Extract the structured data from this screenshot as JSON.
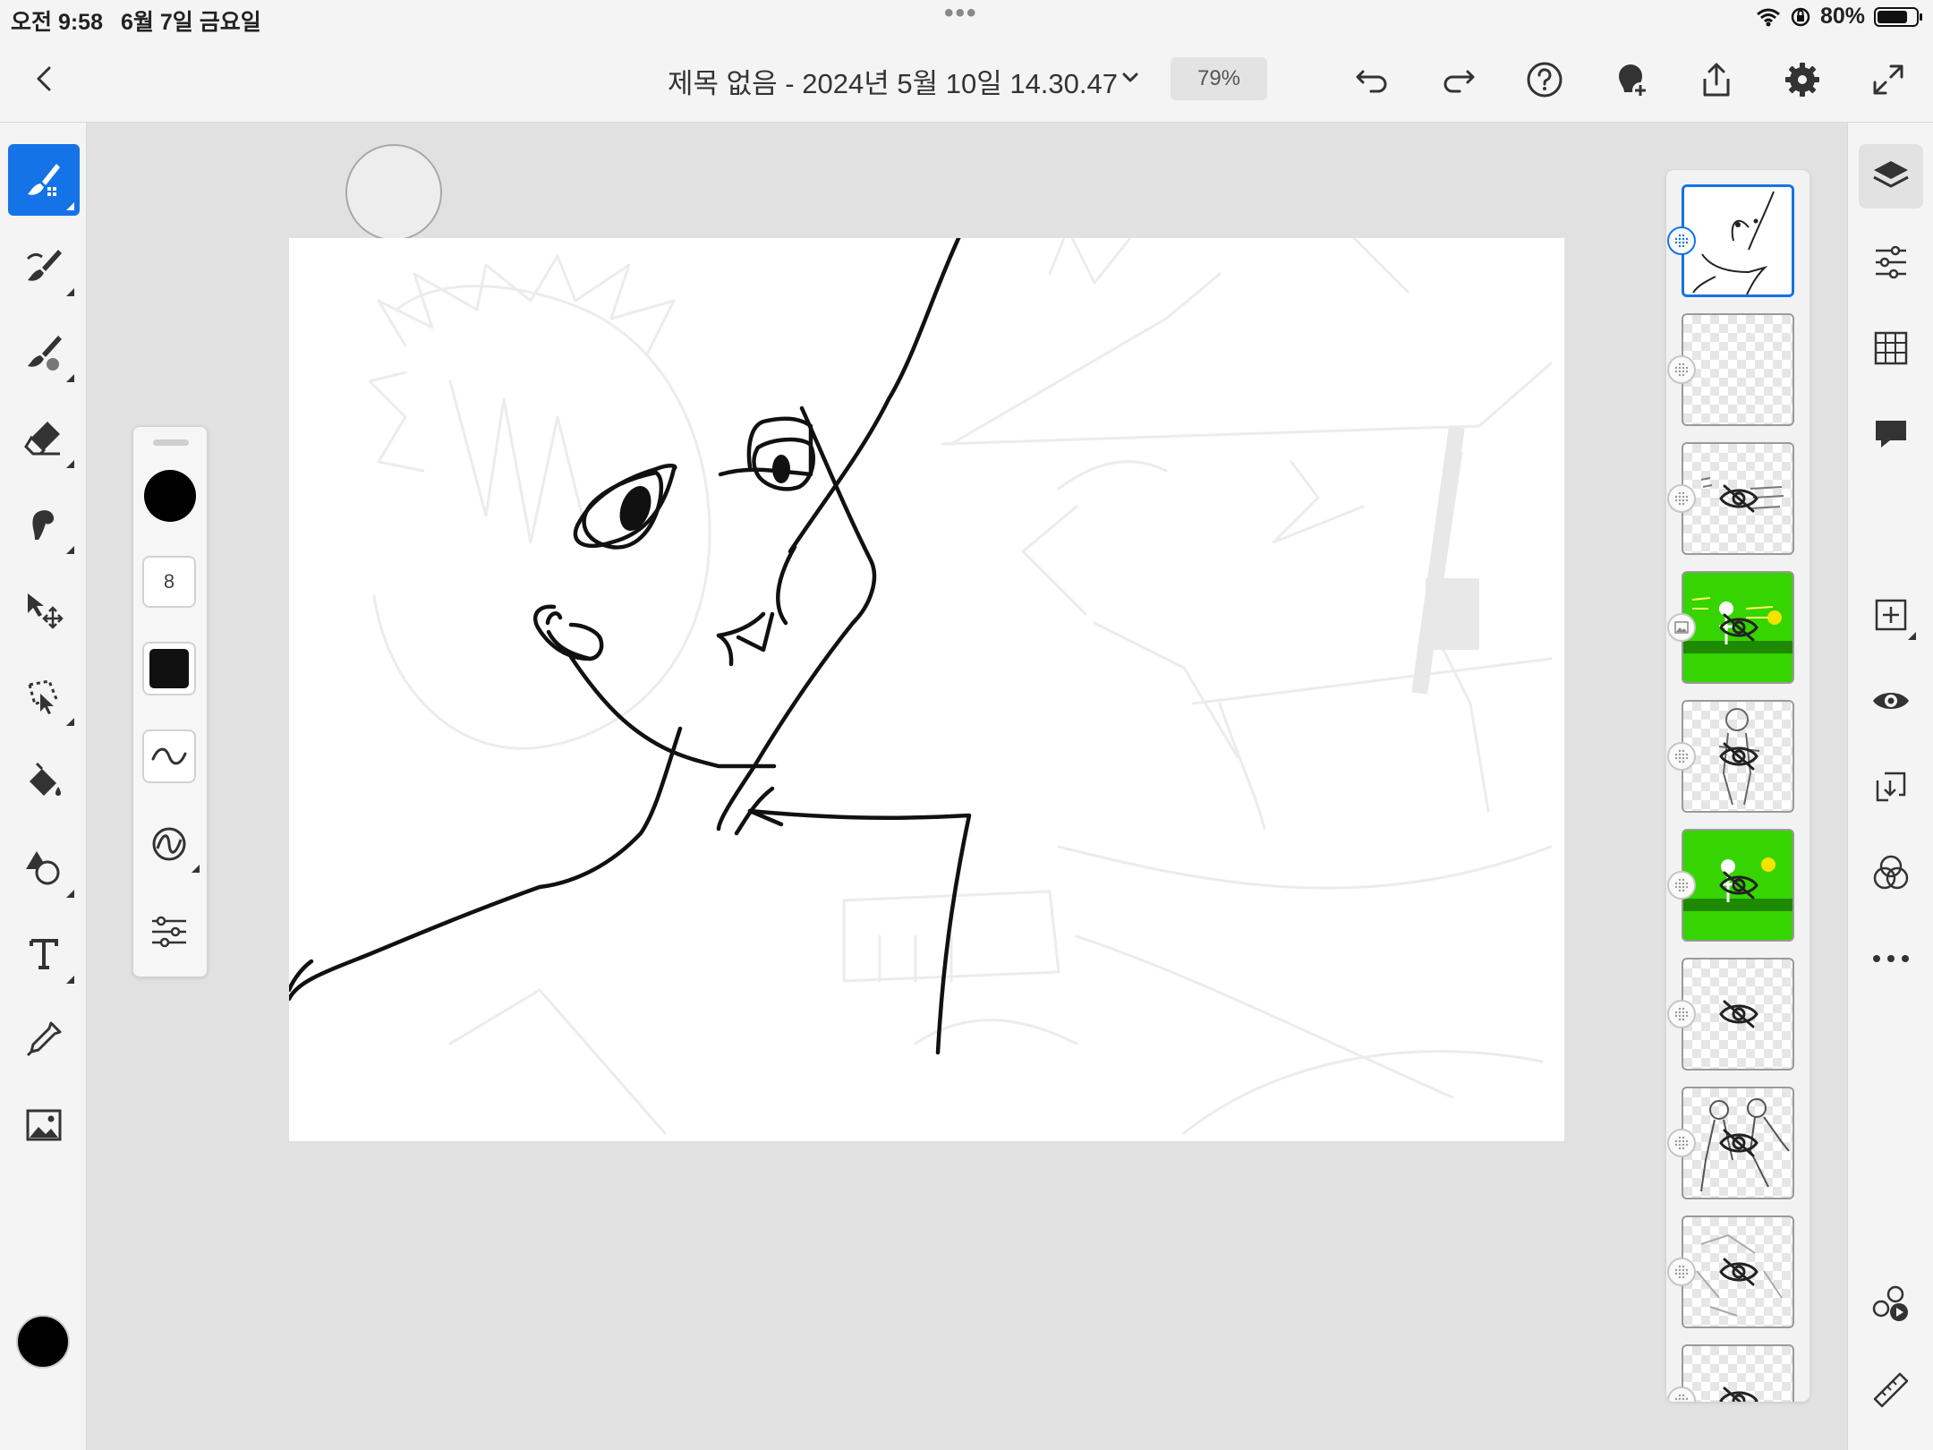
{
  "status_bar": {
    "time": "오전 9:58",
    "date": "6월 7일 금요일",
    "battery_percent": "80%",
    "battery_level": 0.8,
    "icons": [
      "wifi-icon",
      "orientation-lock-icon",
      "battery-icon"
    ]
  },
  "header": {
    "back_icon": "chevron-left-icon",
    "document_title": "제목 없음 - 2024년 5월 10일 14.30.47",
    "zoom": "79%",
    "actions": [
      "undo-icon",
      "redo-icon",
      "help-icon",
      "invite-icon",
      "share-icon",
      "settings-icon",
      "fullscreen-icon"
    ]
  },
  "tools": [
    {
      "name": "pixel-brush-icon",
      "active": true
    },
    {
      "name": "paint-brush-icon",
      "active": false
    },
    {
      "name": "live-brush-icon",
      "active": false
    },
    {
      "name": "eraser-icon",
      "active": false
    },
    {
      "name": "smudge-icon",
      "active": false
    },
    {
      "name": "transform-icon",
      "active": false
    },
    {
      "name": "lasso-select-icon",
      "active": false
    },
    {
      "name": "fill-icon",
      "active": false
    },
    {
      "name": "shapes-icon",
      "active": false
    },
    {
      "name": "text-icon",
      "active": false
    },
    {
      "name": "eyedropper-icon",
      "active": false
    },
    {
      "name": "image-icon",
      "active": false
    }
  ],
  "current_color": "#000000",
  "brush_settings": {
    "size": "8",
    "color": "#000000",
    "opacity_color": "#111111",
    "items": [
      "smoothing-icon",
      "pressure-dynamics-icon",
      "brush-settings-icon"
    ]
  },
  "layers": [
    {
      "thumb": "sketch-face",
      "selected": true,
      "visible": true,
      "type": "pixel"
    },
    {
      "thumb": "empty",
      "selected": false,
      "visible": true,
      "type": "pixel"
    },
    {
      "thumb": "text-notes",
      "selected": false,
      "visible": false,
      "type": "pixel"
    },
    {
      "thumb": "green-scene-text",
      "selected": false,
      "visible": false,
      "type": "image"
    },
    {
      "thumb": "character-sketch",
      "selected": false,
      "visible": false,
      "type": "pixel"
    },
    {
      "thumb": "green-scene",
      "selected": false,
      "visible": false,
      "type": "pixel"
    },
    {
      "thumb": "empty",
      "selected": false,
      "visible": false,
      "type": "pixel"
    },
    {
      "thumb": "character-group",
      "selected": false,
      "visible": false,
      "type": "pixel"
    },
    {
      "thumb": "faint-sketch",
      "selected": false,
      "visible": false,
      "type": "pixel"
    },
    {
      "thumb": "empty",
      "selected": false,
      "visible": false,
      "type": "pixel"
    }
  ],
  "right_tools": [
    "layers-icon",
    "layer-properties-icon",
    "grid-icon",
    "comments-icon",
    "add-layer-icon",
    "visibility-icon",
    "merge-layer-icon",
    "blend-mode-icon",
    "more-icon",
    "livestream-icon",
    "ruler-icon"
  ],
  "accent_color": "#1473e6",
  "layer_green": "#36d400"
}
